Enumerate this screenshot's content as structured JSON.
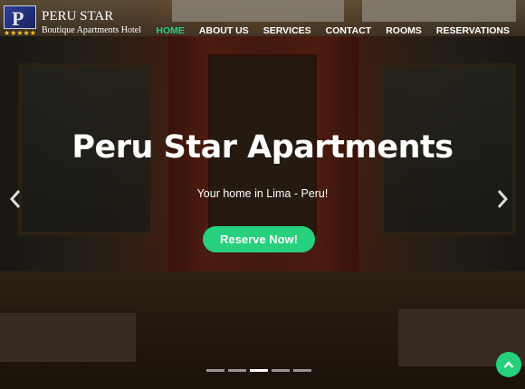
{
  "logo": {
    "mark": "P",
    "stars": "★★★★★",
    "name": "PERU STAR",
    "tagline": "Boutique Apartments Hotel"
  },
  "nav": {
    "items": [
      {
        "label": "HOME",
        "active": true
      },
      {
        "label": "ABOUT US",
        "active": false
      },
      {
        "label": "SERVICES",
        "active": false
      },
      {
        "label": "CONTACT",
        "active": false
      },
      {
        "label": "ROOMS",
        "active": false
      },
      {
        "label": "RESERVATIONS",
        "active": false
      }
    ]
  },
  "hero": {
    "title": "Peru Star Apartments",
    "subtitle": "Your home in Lima - Peru!",
    "cta_label": "Reserve Now!"
  },
  "carousel": {
    "slide_count": 5,
    "active_index": 2,
    "prev_icon": "chevron-left-icon",
    "next_icon": "chevron-right-icon"
  },
  "scroll_top": {
    "icon": "chevron-up-icon"
  },
  "colors": {
    "accent": "#26d07c",
    "text": "#ffffff",
    "star": "#f3c623"
  }
}
